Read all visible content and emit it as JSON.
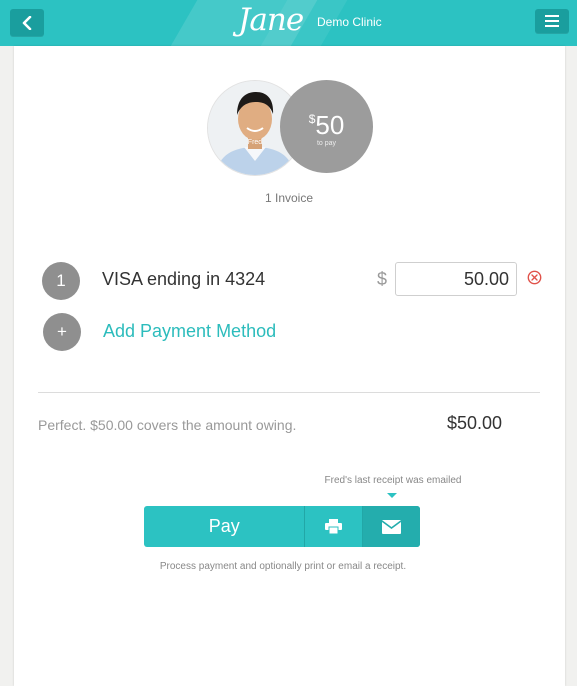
{
  "header": {
    "logo": "Jane",
    "clinic_name": "Demo Clinic",
    "back_icon": "chevron-left-icon",
    "menu_icon": "hamburger-icon"
  },
  "patient": {
    "first_name": "Fred",
    "amount": "50",
    "amount_currency": "$",
    "amount_caption": "to pay",
    "invoice_count": "1 Invoice"
  },
  "payment_methods": [
    {
      "number": "1",
      "label": "VISA ending in 4324",
      "currency": "$",
      "amount": "50.00"
    }
  ],
  "add_method": {
    "icon": "+",
    "label": "Add Payment Method"
  },
  "summary": {
    "message": "Perfect. $50.00 covers the amount owing.",
    "total": "$50.00"
  },
  "receipt_note": "Fred's last receipt was emailed",
  "actions": {
    "pay_label": "Pay",
    "print_icon": "printer-icon",
    "email_icon": "envelope-icon"
  },
  "help_text": "Process payment and optionally print or email a receipt.",
  "colors": {
    "accent": "#2cc2c2",
    "accent_dark": "#1a9e9e",
    "remove": "#e0524a",
    "muted_circle": "#8f8f8f"
  }
}
